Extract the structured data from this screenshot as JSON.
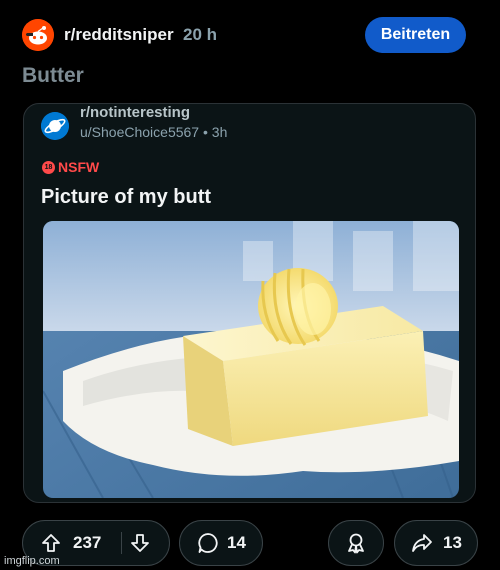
{
  "header": {
    "subreddit": "r/redditsniper",
    "time": "20 h",
    "join_label": "Beitreten"
  },
  "post": {
    "title": "Butter"
  },
  "crosspost": {
    "subreddit": "r/notinteresting",
    "meta": "u/ShoeChoice5567 • 3h",
    "nsfw_label": "NSFW",
    "nsfw_icon_text": "18",
    "title": "Picture of my butt",
    "image_subject": "block of butter on paper"
  },
  "actions": {
    "upvotes": "237",
    "comments": "14",
    "shares": "13"
  },
  "watermark": "imgflip.com",
  "colors": {
    "background": "#000000",
    "join_button": "#115bca",
    "nsfw": "#ff4a4a",
    "subreddit_icon": "#ff4500",
    "crosspost_icon": "#0079d3"
  }
}
